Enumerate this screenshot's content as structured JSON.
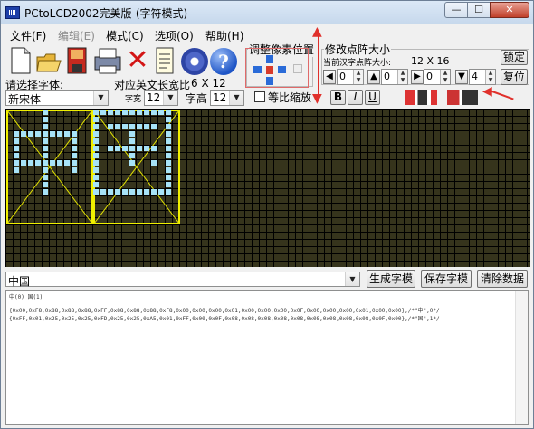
{
  "window": {
    "title": "PCtoLCD2002完美版-(字符模式)",
    "controls": {
      "minimize": "—",
      "maximize": "☐",
      "close": "✕"
    }
  },
  "menu": [
    {
      "label": "文件(F)",
      "enabled": true
    },
    {
      "label": "编辑(E)",
      "enabled": false
    },
    {
      "label": "模式(C)",
      "enabled": true
    },
    {
      "label": "选项(O)",
      "enabled": true
    },
    {
      "label": "帮助(H)",
      "enabled": true
    }
  ],
  "toolbar": {
    "icons": [
      "new-file-icon",
      "open-folder-icon",
      "save-disk-icon",
      "print-icon",
      "delete-x-icon",
      "document-icon",
      "settings-gear-icon",
      "help-icon"
    ],
    "help_glyph": "?",
    "delete_glyph": "✕"
  },
  "pixel_adjust": {
    "title": "调整像素位置"
  },
  "dot_size": {
    "title": "修改点阵大小",
    "current_label": "当前汉字点阵大小:",
    "current_value": "12 X 16",
    "lock_button": "锁定",
    "reset_button": "复位",
    "spinners": [
      "0",
      "0",
      "0",
      "4"
    ]
  },
  "font_select": {
    "label": "请选择字体:",
    "font": "新宋体",
    "en_width_label": "对应英文长宽比",
    "en_width_value": "6 X 12",
    "width_label": "字宽",
    "width_value": "12",
    "height_label": "字高",
    "height_value": "12",
    "proportional_label": "等比缩放"
  },
  "format_buttons": {
    "bold": "B",
    "italic": "I",
    "underline": "U"
  },
  "input": {
    "text": "中国"
  },
  "actions": {
    "generate": "生成字模",
    "save": "保存字模",
    "clear": "清除数据"
  },
  "output": {
    "header": "中(0) 国(1)",
    "lines": [
      "{0x00,0xF8,0x88,0x88,0x88,0xFF,0x88,0x88,0x88,0xF8,0x00,0x00,0x00,0x01,0x00,0x00,0x00,0x0F,0x00,0x00,0x00,0x01,0x00,0x00},/*\"中\",0*/",
      "{0xFF,0x01,0x25,0x25,0x25,0xFD,0x25,0x25,0xA5,0x01,0xFF,0x00,0x0F,0x08,0x08,0x08,0x08,0x08,0x08,0x08,0x08,0x08,0x0F,0x00},/*\"国\",1*/"
    ]
  }
}
